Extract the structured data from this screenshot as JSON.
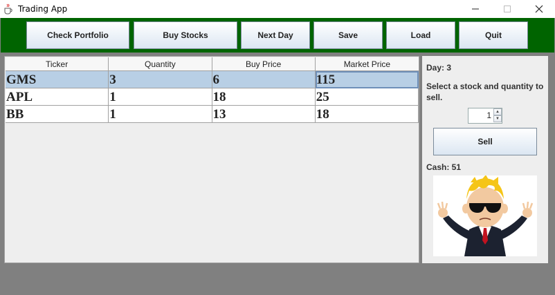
{
  "window": {
    "title": "Trading App",
    "icon": "java-cup-icon",
    "controls": [
      "minimize-icon",
      "maximize-icon",
      "close-icon"
    ]
  },
  "toolbar": {
    "background_color": "#006400",
    "buttons": [
      {
        "label": "Check Portfolio"
      },
      {
        "label": "Buy Stocks"
      },
      {
        "label": "Next Day"
      },
      {
        "label": "Save"
      },
      {
        "label": "Load"
      },
      {
        "label": "Quit"
      }
    ]
  },
  "table": {
    "columns": [
      "Ticker",
      "Quantity",
      "Buy Price",
      "Market Price"
    ],
    "rows": [
      {
        "ticker": "GMS",
        "quantity": "3",
        "buy_price": "6",
        "market_price": "115",
        "selected": true
      },
      {
        "ticker": "APL",
        "quantity": "1",
        "buy_price": "18",
        "market_price": "25",
        "selected": false
      },
      {
        "ticker": "BB",
        "quantity": "1",
        "buy_price": "13",
        "market_price": "18",
        "selected": false
      }
    ],
    "selection_color": "#b8cfe5"
  },
  "side": {
    "day_text": "Day: 3",
    "instruction": "Select a stock and quantity to sell.",
    "quantity_value": "1",
    "sell_label": "Sell",
    "cash_text": "Cash: 51",
    "image": "stonks-man-mascot-icon"
  }
}
